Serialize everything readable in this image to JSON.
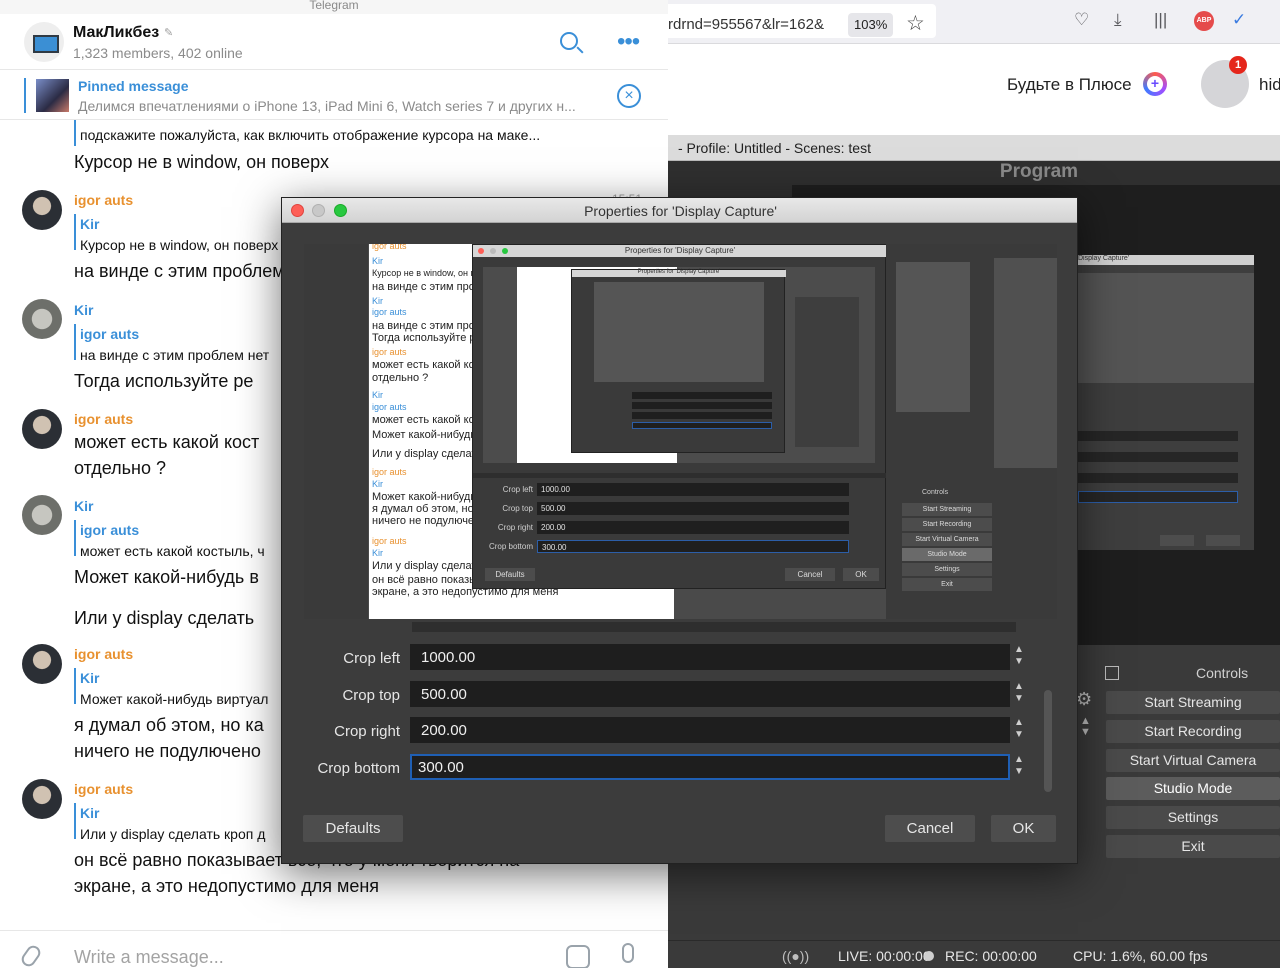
{
  "telegram": {
    "window_title": "Telegram",
    "channel": {
      "name": "МакЛикбез",
      "muted_icon": "mute-icon",
      "subtitle": "1,323 members, 402 online"
    },
    "pinned": {
      "title": "Pinned message",
      "text": "Делимся впечатлениями о iPhone 13, iPad Mini 6, Watch series 7 и других н..."
    },
    "top_reply_text": "подскажите пожалуйста, как включить отображение курсора на маке...",
    "top_message_text": "Курсор не в window, он поверх",
    "timestamp": "15:51",
    "messages": [
      {
        "sender": "igor auts",
        "reply_name": "Kir",
        "reply_text": "Курсор не в window, он поверх",
        "text": [
          "на винде с этим проблем нет"
        ]
      },
      {
        "sender": "Kir",
        "reply_name": "igor auts",
        "reply_text": "на винде с этим проблем нет",
        "text": [
          "Тогда используйте ре"
        ]
      },
      {
        "sender": "igor auts",
        "reply_name": "",
        "reply_text": "",
        "text": [
          "может есть какой кост",
          "отдельно ?"
        ]
      },
      {
        "sender": "Kir",
        "reply_name": "igor auts",
        "reply_text": "может есть какой костыль, ч",
        "text": [
          "Может какой-нибудь в",
          "Или у display сделать"
        ]
      },
      {
        "sender": "igor auts",
        "reply_name": "Kir",
        "reply_text": "Может какой-нибудь виртуал",
        "text": [
          "я думал об этом, но ка",
          "ничего не подулючено"
        ]
      },
      {
        "sender": "igor auts",
        "reply_name": "Kir",
        "reply_text": "Или у display сделать кроп д",
        "text": [
          "он всё равно показывает всё, что у меня творится на",
          "экране, а это недопустимо для меня"
        ]
      }
    ],
    "composer_placeholder": "Write a message..."
  },
  "browser": {
    "url_fragment": "rdrnd=955567&lr=162&",
    "zoom": "103%",
    "plus_text": "Будьте в Плюсе",
    "notification_count": "1",
    "user_fragment": "hid"
  },
  "obs": {
    "window_title": "- Profile: Untitled - Scenes: test",
    "program_label": "Program",
    "controls_label": "Controls",
    "controls": [
      "Start Streaming",
      "Start Recording",
      "Start Virtual Camera",
      "Studio Mode",
      "Settings",
      "Exit"
    ],
    "active_control": "Studio Mode",
    "status": {
      "live": "LIVE: 00:00:00",
      "rec": "REC: 00:00:00",
      "cpu": "CPU: 1.6%, 60.00 fps"
    }
  },
  "dialog": {
    "title": "Properties for 'Display Capture'",
    "fields": [
      {
        "label": "Crop left",
        "value": "1000.00"
      },
      {
        "label": "Crop top",
        "value": "500.00"
      },
      {
        "label": "Crop right",
        "value": "200.00"
      },
      {
        "label": "Crop bottom",
        "value": "300.00"
      }
    ],
    "focused_field": "Crop bottom",
    "buttons": {
      "defaults": "Defaults",
      "cancel": "Cancel",
      "ok": "OK"
    },
    "preview": {
      "inner_title": "Properties for 'Display Capture'",
      "deep_title": "Properties for 'Display Capture'",
      "far_title": "Display Capture'",
      "chat_lines": [
        {
          "t": "igor auts",
          "c": "o"
        },
        {
          "t": "Kir",
          "c": "b"
        },
        {
          "t": "Курсор не в window, он поверх",
          "c": ""
        },
        {
          "t": "на винде с этим пробл",
          "c": ""
        },
        {
          "t": "Kir",
          "c": "b"
        },
        {
          "t": "igor auts",
          "c": "b"
        },
        {
          "t": "на винде с этим проблем нет",
          "c": ""
        },
        {
          "t": "Тогда используйте ре",
          "c": ""
        },
        {
          "t": "igor auts",
          "c": "o"
        },
        {
          "t": "может есть какой кост",
          "c": ""
        },
        {
          "t": "отдельно ?",
          "c": ""
        },
        {
          "t": "Kir",
          "c": "b"
        },
        {
          "t": "igor auts",
          "c": "b"
        },
        {
          "t": "может есть какой костыль, ч",
          "c": ""
        },
        {
          "t": "Может какой-нибудь в",
          "c": ""
        },
        {
          "t": "Или у display сделать",
          "c": ""
        },
        {
          "t": "igor auts",
          "c": "o"
        },
        {
          "t": "Kir",
          "c": "b"
        },
        {
          "t": "Может какой-нибудь виртуа",
          "c": ""
        },
        {
          "t": "я думал об этом, но ка",
          "c": ""
        },
        {
          "t": "ничего не подулючено",
          "c": ""
        },
        {
          "t": "igor auts",
          "c": "o"
        },
        {
          "t": "Kir",
          "c": "b"
        },
        {
          "t": "Или у display сделать кроп д",
          "c": ""
        },
        {
          "t": "он всё равно показывает всё, что у меня творится на",
          "c": ""
        },
        {
          "t": "экране, а это недопустимо для меня",
          "c": ""
        }
      ]
    }
  },
  "colors": {
    "telegram_accent": "#3a8fd8",
    "sender_orange": "#e8912f",
    "obs_background": "#3c3c3c",
    "field_background": "#1e1e1e",
    "focus_ring": "#1f5fb4"
  }
}
